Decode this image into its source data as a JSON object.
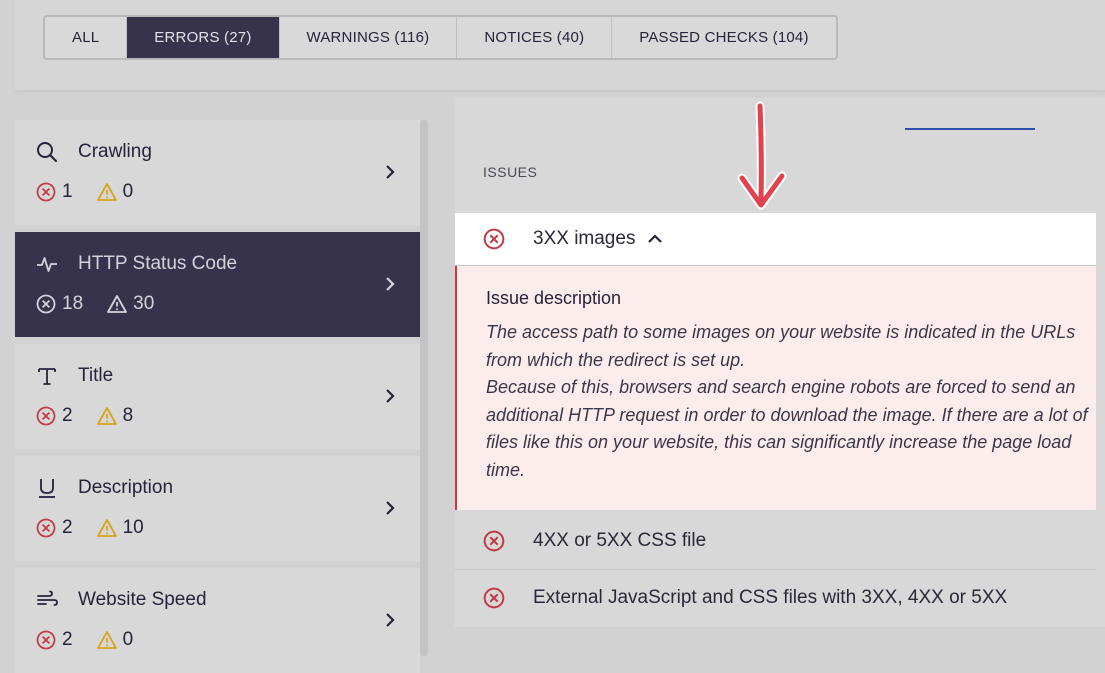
{
  "tabs": [
    {
      "label": "ALL",
      "active": false
    },
    {
      "label": "ERRORS (27)",
      "active": true
    },
    {
      "label": "WARNINGS (116)",
      "active": false
    },
    {
      "label": "NOTICES (40)",
      "active": false
    },
    {
      "label": "PASSED CHECKS (104)",
      "active": false
    }
  ],
  "categories": [
    {
      "title": "Crawling",
      "icon": "search-icon",
      "errors": "1",
      "warnings": "0",
      "active": false
    },
    {
      "title": "HTTP Status Code",
      "icon": "pulse-icon",
      "errors": "18",
      "warnings": "30",
      "active": true
    },
    {
      "title": "Title",
      "icon": "text-t-icon",
      "errors": "2",
      "warnings": "8",
      "active": false
    },
    {
      "title": "Description",
      "icon": "underline-u-icon",
      "errors": "2",
      "warnings": "10",
      "active": false
    },
    {
      "title": "Website Speed",
      "icon": "wind-icon",
      "errors": "2",
      "warnings": "0",
      "active": false
    }
  ],
  "issues_label": "ISSUES",
  "issues": [
    {
      "title": "3XX images",
      "expanded": true
    },
    {
      "title": "4XX or 5XX CSS file",
      "expanded": false
    },
    {
      "title": "External JavaScript and CSS files with 3XX, 4XX or 5XX",
      "expanded": false
    }
  ],
  "issue_description": {
    "title": "Issue description",
    "line1": "The access path to some images on your website is indicated in the URLs from which the redirect is set up.",
    "line2": "Because of this, browsers and search engine robots are forced to send an additional HTTP request in order to download the image. If there are a lot of files like this on your website, this can significantly increase the page load time."
  },
  "colors": {
    "accent_dark": "#37334d",
    "error_red": "#c23a44",
    "warning_yellow": "#d9a21e",
    "annotation_arrow": "#e0434d",
    "description_bg": "#fcecec"
  }
}
